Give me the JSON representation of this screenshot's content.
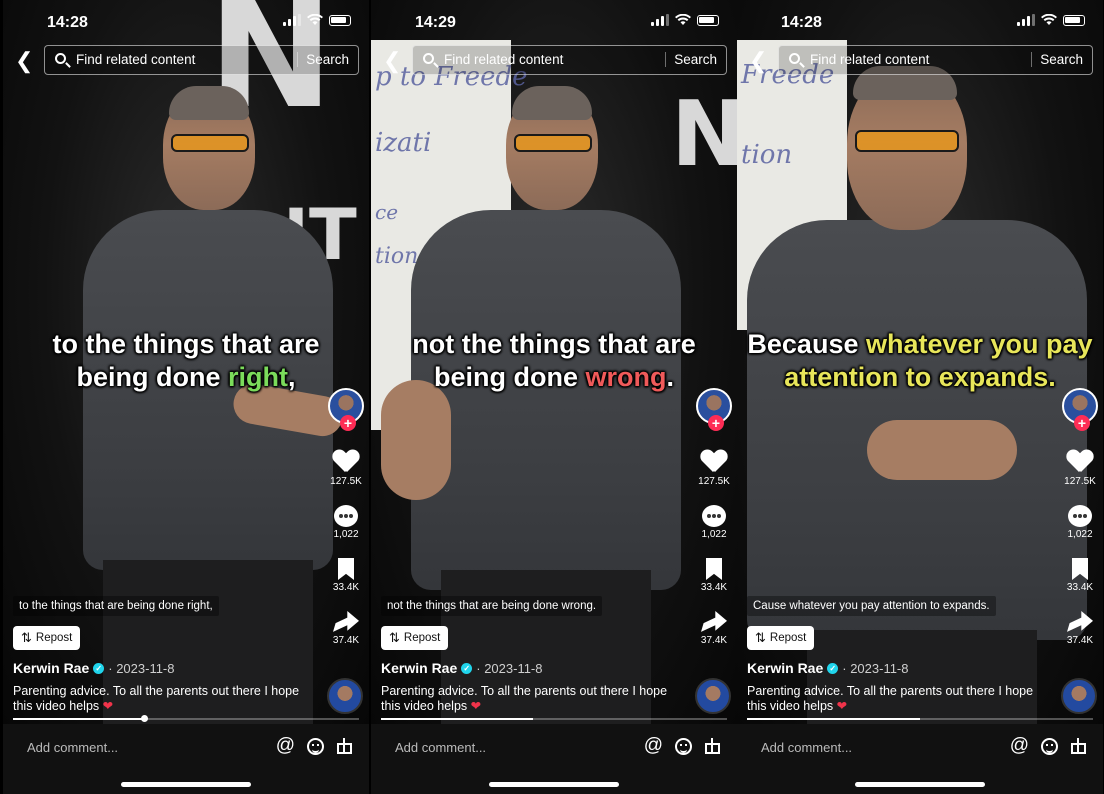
{
  "panels": [
    {
      "status": {
        "time": "14:28"
      },
      "search": {
        "placeholder": "Find related content",
        "button": "Search"
      },
      "caption": {
        "before": "to the things that are",
        "line2_before": "being done ",
        "highlight": "right",
        "after": ","
      },
      "rail": {
        "likes": "127.5K",
        "comments": "1,022",
        "saves": "33.4K",
        "shares": "37.4K"
      },
      "subtitle": "to the things that are being done right,",
      "repost_label": "Repost",
      "author": "Kerwin Rae",
      "date": "· 2023-11-8",
      "description": "Parenting advice. To all the parents out there I hope this video helps",
      "progress": 0.38,
      "comment_placeholder": "Add comment..."
    },
    {
      "status": {
        "time": "14:29"
      },
      "search": {
        "placeholder": "Find related content",
        "button": "Search"
      },
      "caption": {
        "before": "not the things that are",
        "line2_before": "being done ",
        "highlight": "wrong",
        "after": "."
      },
      "rail": {
        "likes": "127.5K",
        "comments": "1,022",
        "saves": "33.4K",
        "shares": "37.4K"
      },
      "subtitle": "not the things that are being done wrong.",
      "repost_label": "Repost",
      "author": "Kerwin Rae",
      "date": "· 2023-11-8",
      "description": "Parenting advice. To all the parents out there I hope this video helps",
      "progress": 0.44,
      "comment_placeholder": "Add comment..."
    },
    {
      "status": {
        "time": "14:28"
      },
      "search": {
        "placeholder": "Find related content",
        "button": "Search"
      },
      "caption": {
        "before_plain": "Because ",
        "before_hl": "whatever you pay",
        "line2_hl": "attention to expands."
      },
      "rail": {
        "likes": "127.5K",
        "comments": "1,022",
        "saves": "33.4K",
        "shares": "37.4K"
      },
      "subtitle": "Cause whatever you pay attention to expands.",
      "repost_label": "Repost",
      "author": "Kerwin Rae",
      "date": "· 2023-11-8",
      "description": "Parenting advice. To all the parents out there I hope this video helps",
      "progress": 0.5,
      "comment_placeholder": "Add comment..."
    }
  ],
  "icons": {
    "back": "chevron-left-icon",
    "search": "search-icon",
    "like": "heart-icon",
    "comment": "comment-icon",
    "save": "bookmark-icon",
    "share": "share-icon",
    "repost": "repost-icon",
    "mention": "at-icon",
    "emoji": "emoji-icon",
    "gift": "gift-icon"
  },
  "colors": {
    "caption_green": "#7bdc5b",
    "caption_red": "#f05a5a",
    "caption_yellow": "#e8e65a",
    "follow_plus": "#fe2c55",
    "verified": "#20d5ec"
  }
}
